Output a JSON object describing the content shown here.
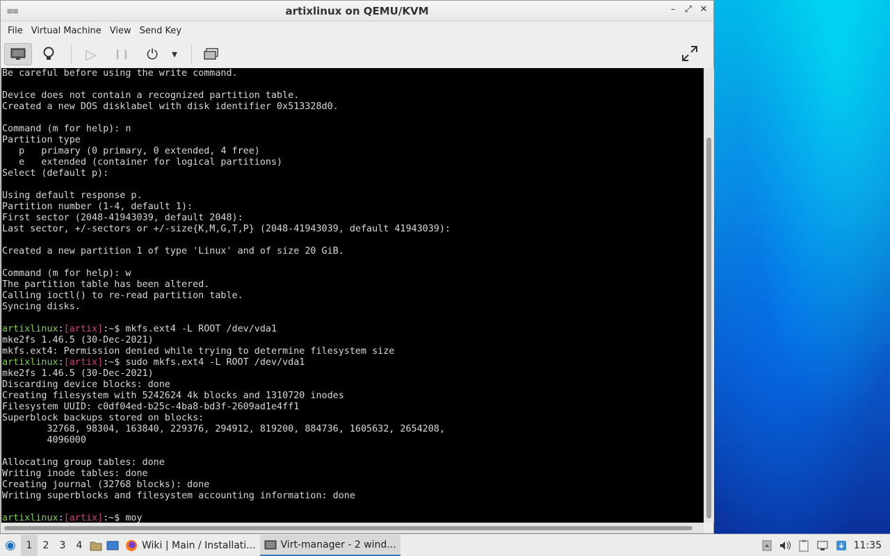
{
  "window": {
    "title": "artixlinux on QEMU/KVM",
    "app_icon": "≡≡",
    "minimize": "–",
    "restore": "⤢",
    "close": "✕"
  },
  "menubar": {
    "file": "File",
    "virtual_machine": "Virtual Machine",
    "view": "View",
    "send_key": "Send Key"
  },
  "toolbar": {
    "console_icon": "🖥",
    "details_icon": "💡",
    "run_icon": "▷",
    "pause_icon": "❙❙",
    "power_icon": "⏻",
    "power_menu_icon": "▾",
    "snapshots_icon": "⧉",
    "fullscreen_icon": "⤢"
  },
  "console": {
    "lines": [
      {
        "text": "Be careful before using the write command."
      },
      {
        "text": ""
      },
      {
        "text": "Device does not contain a recognized partition table."
      },
      {
        "text": "Created a new DOS disklabel with disk identifier 0x513328d0."
      },
      {
        "text": ""
      },
      {
        "text": "Command (m for help): n"
      },
      {
        "text": "Partition type"
      },
      {
        "text": "   p   primary (0 primary, 0 extended, 4 free)"
      },
      {
        "text": "   e   extended (container for logical partitions)"
      },
      {
        "text": "Select (default p):"
      },
      {
        "text": ""
      },
      {
        "text": "Using default response p."
      },
      {
        "text": "Partition number (1-4, default 1):"
      },
      {
        "text": "First sector (2048-41943039, default 2048):"
      },
      {
        "text": "Last sector, +/-sectors or +/-size{K,M,G,T,P} (2048-41943039, default 41943039):"
      },
      {
        "text": ""
      },
      {
        "text": "Created a new partition 1 of type 'Linux' and of size 20 GiB."
      },
      {
        "text": ""
      },
      {
        "text": "Command (m for help): w"
      },
      {
        "text": "The partition table has been altered."
      },
      {
        "text": "Calling ioctl() to re-read partition table."
      },
      {
        "text": "Syncing disks."
      },
      {
        "text": ""
      },
      {
        "prompt": true,
        "user": "artixlinux",
        "host": "artix",
        "cmd": "mkfs.ext4 -L ROOT /dev/vda1"
      },
      {
        "text": "mke2fs 1.46.5 (30-Dec-2021)"
      },
      {
        "text": "mkfs.ext4: Permission denied while trying to determine filesystem size"
      },
      {
        "prompt": true,
        "user": "artixlinux",
        "host": "artix",
        "cmd": "sudo mkfs.ext4 -L ROOT /dev/vda1"
      },
      {
        "text": "mke2fs 1.46.5 (30-Dec-2021)"
      },
      {
        "text": "Discarding device blocks: done"
      },
      {
        "text": "Creating filesystem with 5242624 4k blocks and 1310720 inodes"
      },
      {
        "text": "Filesystem UUID: c0df04ed-b25c-4ba8-bd3f-2609ad1e4ff1"
      },
      {
        "text": "Superblock backups stored on blocks:"
      },
      {
        "text": "        32768, 98304, 163840, 229376, 294912, 819200, 884736, 1605632, 2654208,"
      },
      {
        "text": "        4096000"
      },
      {
        "text": ""
      },
      {
        "text": "Allocating group tables: done"
      },
      {
        "text": "Writing inode tables: done"
      },
      {
        "text": "Creating journal (32768 blocks): done"
      },
      {
        "text": "Writing superblocks and filesystem accounting information: done"
      },
      {
        "text": ""
      },
      {
        "prompt": true,
        "user": "artixlinux",
        "host": "artix",
        "cmd": "moy"
      }
    ]
  },
  "taskbar": {
    "start_icon": "◉",
    "workspaces": [
      "1",
      "2",
      "3",
      "4"
    ],
    "active_workspace": "1",
    "files_icon": "🗀",
    "desktop_icon": "▭",
    "tasks": [
      {
        "label": "Wiki | Main / Installati...",
        "icon": "firefox-icon"
      },
      {
        "label": "Virt-manager - 2 wind...",
        "icon": "virt-manager-icon"
      }
    ],
    "tray": {
      "clock": "11:35"
    }
  },
  "colors": {
    "prompt_user": "#7fd24a",
    "prompt_host": "#d04080",
    "console_bg": "#000000",
    "console_fg": "#d8d8d8"
  }
}
